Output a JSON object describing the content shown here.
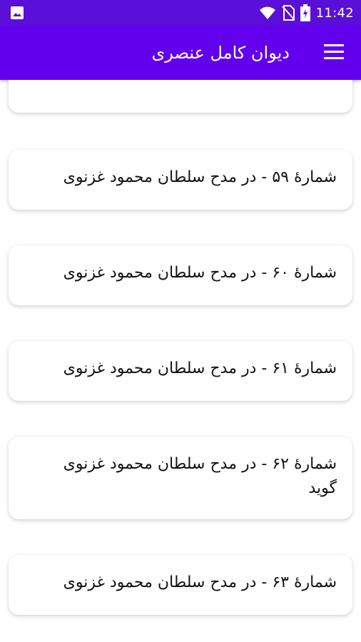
{
  "status_bar": {
    "time": "11:42",
    "icons": [
      "image-icon",
      "wifi-icon",
      "no-sim-icon",
      "battery-charging-icon"
    ]
  },
  "app_bar": {
    "title": "دیوان کامل عنصری",
    "menu_icon": "hamburger-menu-icon"
  },
  "poems": [
    {
      "title": ""
    },
    {
      "title": "شمارهٔ ۵۹ -  در مدح سلطان محمود غزنوی"
    },
    {
      "title": "شمارهٔ ۶۰ -  در مدح سلطان محمود غزنوی"
    },
    {
      "title": "شمارهٔ ۶۱ -  در مدح سلطان محمود غزنوی"
    },
    {
      "title": "شمارهٔ ۶۲ -  در مدح سلطان محمود غزنوی گوید"
    },
    {
      "title": "شمارهٔ ۶۳ -  در مدح سلطان محمود غزنوی"
    }
  ],
  "colors": {
    "status_bar": "#5a0fd8",
    "app_bar": "#6200ee",
    "card_bg": "#ffffff",
    "text": "#111111"
  }
}
